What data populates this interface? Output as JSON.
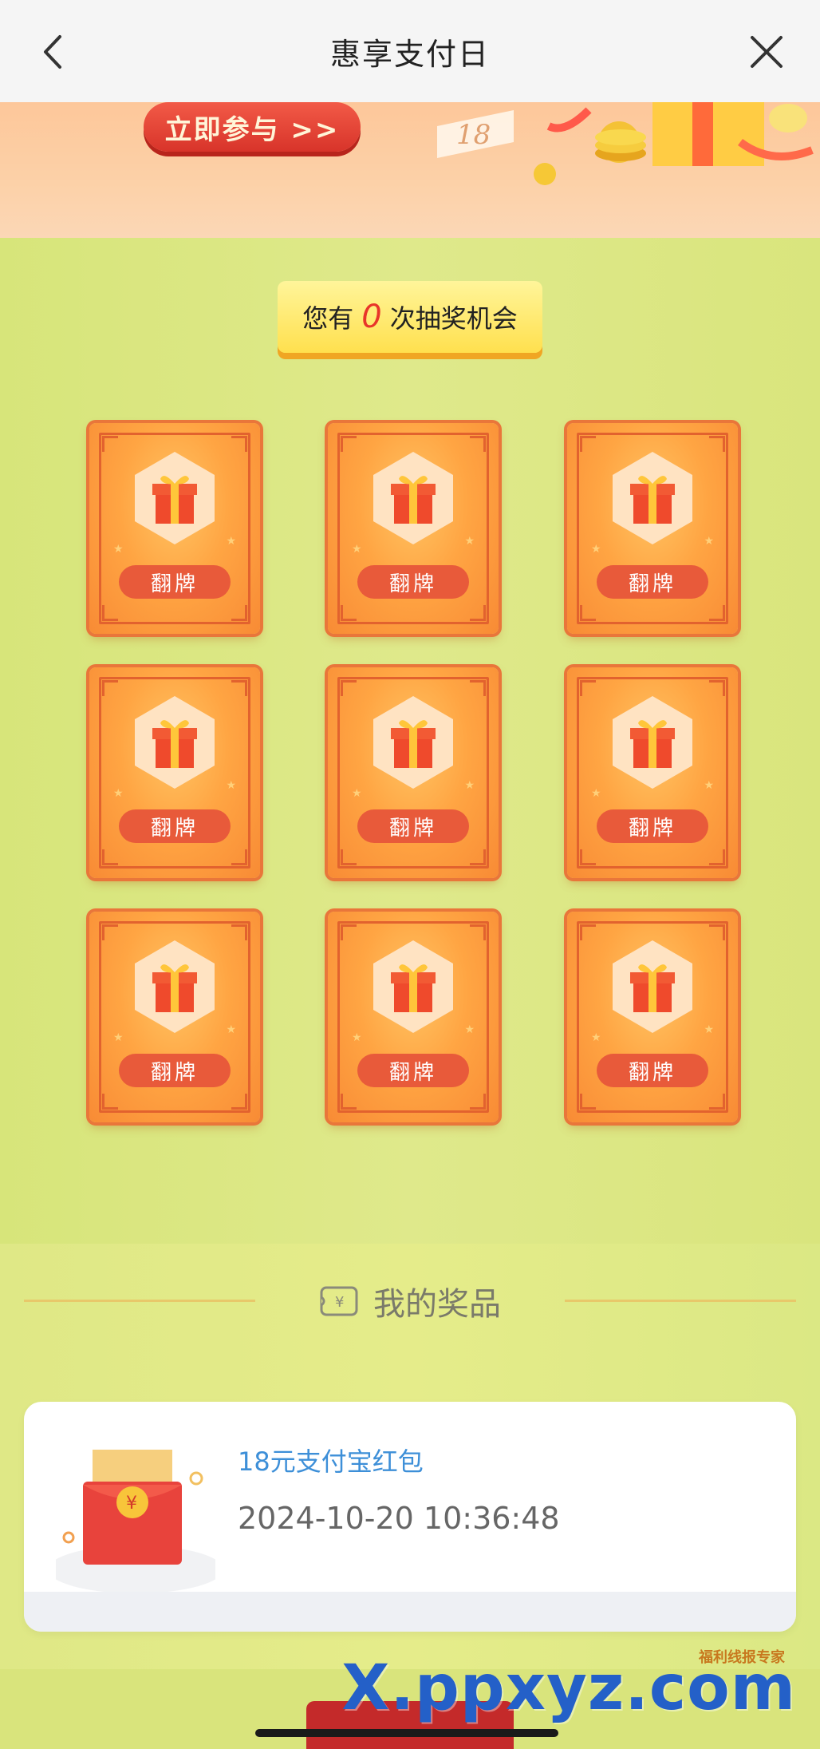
{
  "navbar": {
    "title": "惠享支付日"
  },
  "banner": {
    "join_label": "立即参与 >>",
    "badge_text": "18"
  },
  "lottery": {
    "chance_prefix": "您有",
    "chance_count": "0",
    "chance_suffix": "次抽奖机会",
    "cards": [
      {
        "label": "翻牌"
      },
      {
        "label": "翻牌"
      },
      {
        "label": "翻牌"
      },
      {
        "label": "翻牌"
      },
      {
        "label": "翻牌"
      },
      {
        "label": "翻牌"
      },
      {
        "label": "翻牌"
      },
      {
        "label": "翻牌"
      },
      {
        "label": "翻牌"
      }
    ]
  },
  "prizes": {
    "heading": "我的奖品",
    "items": [
      {
        "name": "18元支付宝红包",
        "time": "2024-10-20 10:36:48"
      }
    ]
  },
  "watermark": {
    "text": "X.ppxyz.com",
    "brand": "福利线报专家"
  },
  "colors": {
    "accent": "#e85a3a",
    "card": "#ffa543",
    "background": "#dfe98a",
    "prize_name": "#3d8fd8"
  },
  "icons": {
    "back": "chevron-left-icon",
    "close": "close-icon",
    "gift": "gift-icon",
    "ticket": "ticket-icon",
    "red_packet": "red-packet-icon"
  }
}
